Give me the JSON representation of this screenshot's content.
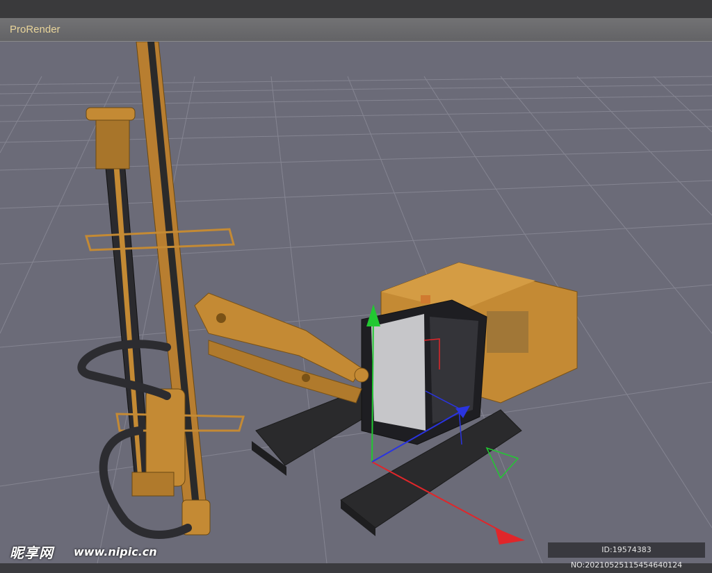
{
  "window": {
    "title": "ProRender"
  },
  "viewport": {
    "background": "#6b6b78",
    "grid_color": "#9a9aa6",
    "axis_colors": {
      "x": "#e0262a",
      "y": "#22c832",
      "z": "#2a34e0"
    },
    "model_color": "#c48a34",
    "object": "tracked drilling rig model"
  },
  "watermark": {
    "logo": "昵享网",
    "url": "www.nipic.cn",
    "id": "ID:19574383 NO:20210525115454640124"
  }
}
